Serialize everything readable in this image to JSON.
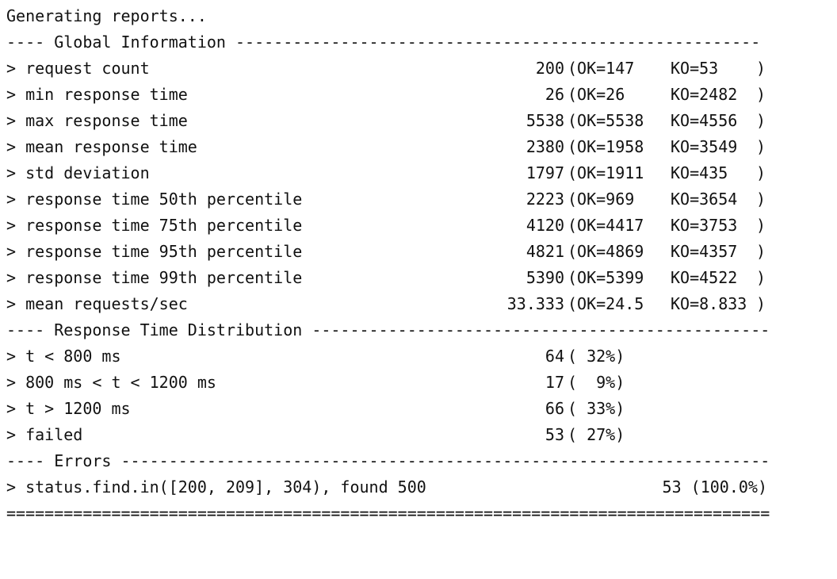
{
  "header": "Generating reports...",
  "sections": {
    "global": "---- Global Information -------------------------------------------------------",
    "distribution": "---- Response Time Distribution ------------------------------------------------",
    "errors": "---- Errors --------------------------------------------------------------------",
    "footer": "================================================================================"
  },
  "stats": [
    {
      "label": "> request count",
      "total": "200",
      "ok": "(OK=147",
      "ko": "KO=53",
      "close": ")"
    },
    {
      "label": "> min response time",
      "total": "26",
      "ok": "(OK=26",
      "ko": "KO=2482",
      "close": ")"
    },
    {
      "label": "> max response time",
      "total": "5538",
      "ok": "(OK=5538",
      "ko": "KO=4556",
      "close": ")"
    },
    {
      "label": "> mean response time",
      "total": "2380",
      "ok": "(OK=1958",
      "ko": "KO=3549",
      "close": ")"
    },
    {
      "label": "> std deviation",
      "total": "1797",
      "ok": "(OK=1911",
      "ko": "KO=435",
      "close": ")"
    },
    {
      "label": "> response time 50th percentile",
      "total": "2223",
      "ok": "(OK=969",
      "ko": "KO=3654",
      "close": ")"
    },
    {
      "label": "> response time 75th percentile",
      "total": "4120",
      "ok": "(OK=4417",
      "ko": "KO=3753",
      "close": ")"
    },
    {
      "label": "> response time 95th percentile",
      "total": "4821",
      "ok": "(OK=4869",
      "ko": "KO=4357",
      "close": ")"
    },
    {
      "label": "> response time 99th percentile",
      "total": "5390",
      "ok": "(OK=5399",
      "ko": "KO=4522",
      "close": ")"
    },
    {
      "label": "> mean requests/sec",
      "total": "33.333",
      "ok": "(OK=24.5",
      "ko": "KO=8.833",
      "close": ")"
    }
  ],
  "distribution": [
    {
      "label": "> t < 800 ms",
      "count": "64",
      "pct": "( 32%)"
    },
    {
      "label": "> 800 ms < t < 1200 ms",
      "count": "17",
      "pct": "(  9%)"
    },
    {
      "label": "> t > 1200 ms",
      "count": "66",
      "pct": "( 33%)"
    },
    {
      "label": "> failed",
      "count": "53",
      "pct": "( 27%)"
    }
  ],
  "errors": [
    {
      "label": "> status.find.in([200, 209], 304), found 500",
      "count": "53 (100.0%)"
    }
  ]
}
